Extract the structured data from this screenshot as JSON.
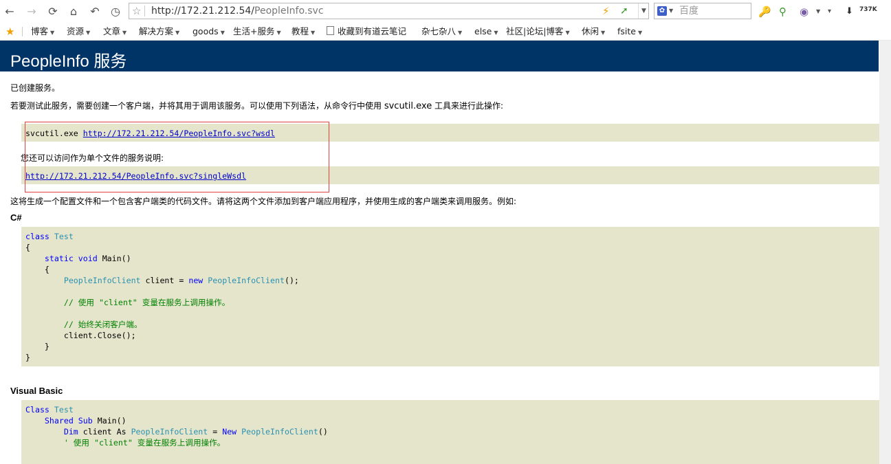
{
  "browser": {
    "url_host": "http://172.21.212.54/",
    "url_path": "PeopleInfo.svc",
    "search_placeholder": "百度",
    "download_count": "737K",
    "bookmarks": [
      {
        "label": "博客",
        "has_menu": true
      },
      {
        "label": "资源",
        "has_menu": true
      },
      {
        "label": "文章",
        "has_menu": true
      },
      {
        "label": "解决方案",
        "has_menu": true
      },
      {
        "label": "goods",
        "has_menu": true
      },
      {
        "label": "生活+服务",
        "has_menu": true
      },
      {
        "label": "教程",
        "has_menu": true
      },
      {
        "label": "收藏到有道云笔记",
        "has_menu": false
      },
      {
        "label": "杂七杂八",
        "has_menu": true
      },
      {
        "label": "else",
        "has_menu": true
      },
      {
        "label": "社区|论坛|博客",
        "has_menu": true
      },
      {
        "label": "休闲",
        "has_menu": true
      },
      {
        "label": "fsite",
        "has_menu": true
      }
    ]
  },
  "page": {
    "title": "PeopleInfo 服务",
    "created_text": "已创建服务。",
    "test_text_pre": "若要测试此服务，需要创建一个客户端，并将其用于调用该服务。可以使用下列语法，从命令行中使用 ",
    "test_text_tool": "svcutil.exe",
    "test_text_post": " 工具来进行此操作:",
    "svcutil_cmd": "svcutil.exe ",
    "wsdl_url": "http://172.21.212.54/PeopleInfo.svc?wsdl",
    "single_file_text": "您还可以访问作为单个文件的服务说明:",
    "single_wsdl_url": "http://172.21.212.54/PeopleInfo.svc?singleWsdl",
    "generate_text": "这将生成一个配置文件和一个包含客户端类的代码文件。请将这两个文件添加到客户端应用程序，并使用生成的客户端类来调用服务。例如:",
    "csharp_heading": "C#",
    "vb_heading": "Visual Basic",
    "csharp": {
      "kw_class": "class",
      "type_test": "Test",
      "brace_open": "{",
      "kw_static": "static",
      "kw_void": "void",
      "main": " Main()",
      "inner_open": "{",
      "type_client": "PeopleInfoClient",
      "client_decl": " client = ",
      "kw_new": "new",
      "call_end": "();",
      "comment_use": "// 使用 \"client\" 变量在服务上调用操作。",
      "comment_close": "// 始终关闭客户端。",
      "close_call": "client.Close();",
      "inner_close": "}",
      "brace_close": "}"
    },
    "vb": {
      "kw_class": "Class",
      "type_test": "Test",
      "kw_shared": "Shared",
      "kw_sub": "Sub",
      "main": " Main()",
      "kw_dim": "Dim",
      "client_as": " client As ",
      "eq": " = ",
      "kw_new": "New",
      "call_end": "()",
      "comment_use": "' 使用 \"client\" 变量在服务上调用操作。"
    }
  }
}
